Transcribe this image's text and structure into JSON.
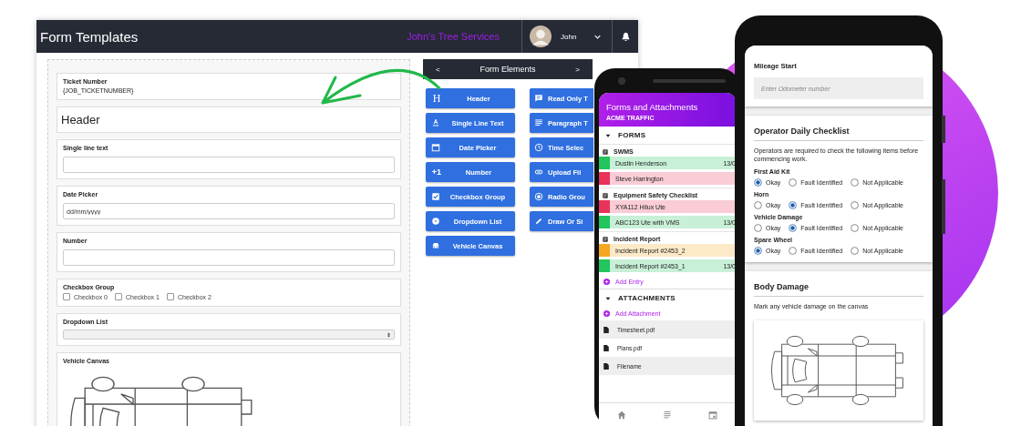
{
  "desktop": {
    "title": "Form Templates",
    "company": "John's Tree Services",
    "user": "John",
    "form_fields": [
      {
        "kind": "static",
        "label": "Ticket Number",
        "value": "{JOB_TICKETNUMBER}"
      },
      {
        "kind": "header",
        "label": "Header"
      },
      {
        "kind": "text",
        "label": "Single line text"
      },
      {
        "kind": "text",
        "label": "Date Picker",
        "placeholder": "dd/mm/yyyy"
      },
      {
        "kind": "text",
        "label": "Number"
      },
      {
        "kind": "checkboxes",
        "label": "Checkbox Group",
        "options": [
          {
            "label": "Checkbox 0",
            "checked": false
          },
          {
            "label": "Checkbox 1",
            "checked": false
          },
          {
            "label": "Checkbox 2",
            "checked": false
          }
        ]
      },
      {
        "kind": "select",
        "label": "Dropdown List"
      },
      {
        "kind": "canvas",
        "label": "Vehicle Canvas"
      }
    ],
    "elements_panel": {
      "title": "Form Elements",
      "prev": "<",
      "next": ">",
      "buttons": [
        {
          "kind": "header",
          "glyph": "H",
          "label": "Header"
        },
        {
          "kind": "readonly",
          "label": "Read Only T"
        },
        {
          "kind": "text",
          "label": "Single Line Text"
        },
        {
          "kind": "paragraph",
          "label": "Paragraph T"
        },
        {
          "kind": "date",
          "label": "Date Picker"
        },
        {
          "kind": "time",
          "label": "Time Selec"
        },
        {
          "kind": "number",
          "glyph": "+1",
          "label": "Number"
        },
        {
          "kind": "upload",
          "label": "Upload Fil"
        },
        {
          "kind": "checkbox",
          "label": "Checkbox Group"
        },
        {
          "kind": "radio",
          "label": "Radio Grou"
        },
        {
          "kind": "dropdown",
          "label": "Dropdown List"
        },
        {
          "kind": "draw",
          "label": "Draw Or Si"
        },
        {
          "kind": "vehicle",
          "label": "Vehicle Canvas"
        }
      ]
    }
  },
  "phone_forms": {
    "title": "Forms and Attachments",
    "subtitle": "ACME TRAFFIC",
    "forms_section": {
      "title": "FORMS",
      "expanded": true,
      "add_label": "Add Entry",
      "groups": [
        {
          "title": "SWMS",
          "entries": [
            {
              "name": "Dustin Henderson",
              "date": "13/0",
              "color": "#22c55e"
            },
            {
              "name": "Steve Harrington",
              "color": "#e8335a"
            }
          ]
        },
        {
          "title": "Equipment Safety Checklist",
          "entries": [
            {
              "name": "XYA112 Hilux Ute",
              "color": "#e8335a"
            },
            {
              "name": "ABC123 Ute with VMS",
              "date": "13/0",
              "color": "#22c55e"
            }
          ]
        },
        {
          "title": "Incident Report",
          "entries": [
            {
              "name": "Incident Report #2453_2",
              "color": "#f5a623"
            },
            {
              "name": "Incident Report #2453_1",
              "date": "13/0",
              "color": "#22c55e"
            }
          ]
        }
      ]
    },
    "attachments_section": {
      "title": "ATTACHMENTS",
      "expanded": true,
      "add_label": "Add Attachment",
      "files": [
        "Timesheet.pdf",
        "Plans.pdf",
        "Filename"
      ]
    }
  },
  "phone_inspection": {
    "mileage": {
      "label": "Mileage Start",
      "placeholder": "Enter Odometer number"
    },
    "checklist": {
      "title": "Operator Daily Checklist",
      "description": "Operators are required to check the following items before commencing work.",
      "questions": [
        {
          "label": "First Aid Kit",
          "options": [
            {
              "label": "Okay",
              "selected": true
            },
            {
              "label": "Fault Identified",
              "selected": false
            },
            {
              "label": "Not Applicable",
              "selected": false
            }
          ]
        },
        {
          "label": "Horn",
          "options": [
            {
              "label": "Okay",
              "selected": false
            },
            {
              "label": "Fault Identified",
              "selected": true
            },
            {
              "label": "Not Applicable",
              "selected": false
            }
          ]
        },
        {
          "label": "Vehicle Damage",
          "options": [
            {
              "label": "Okay",
              "selected": false
            },
            {
              "label": "Fault Identified",
              "selected": true
            },
            {
              "label": "Not Applicable",
              "selected": false
            }
          ]
        },
        {
          "label": "Spare Wheel",
          "options": [
            {
              "label": "Okay",
              "selected": true
            },
            {
              "label": "Fault Identified",
              "selected": false
            },
            {
              "label": "Not Applicable",
              "selected": false
            }
          ]
        }
      ]
    },
    "body_damage": {
      "title": "Body Damage",
      "description": "Mark any vehicle damage on the canvas"
    }
  }
}
